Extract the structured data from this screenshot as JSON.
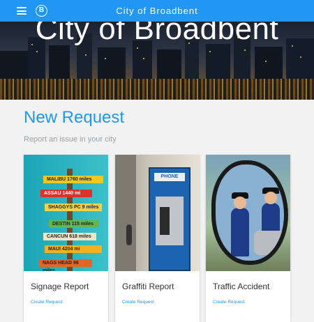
{
  "app": {
    "title": "City of Broadbent",
    "logo_letter": "B"
  },
  "hero": {
    "title": "City of Broadbent"
  },
  "section": {
    "title": "New Request",
    "subtitle": "Report an issue in your city"
  },
  "cards": [
    {
      "title": "Signage Report",
      "link": "Create Request",
      "signs": [
        "MALIBU 1760 miles",
        "ASSAU 1440 mi",
        "SHAGGYS PC 9 miles",
        "DESTIN 115 miles",
        "CANCUN 618 miles",
        "MAUI 4204 mi",
        "NAGS HEAD 96 miles"
      ]
    },
    {
      "title": "Graffiti Report",
      "link": "Create Request",
      "booth_label": "PHONE"
    },
    {
      "title": "Traffic Accident",
      "link": "Create Request"
    }
  ],
  "colors": {
    "primary": "#2196f3",
    "subtitle": "#9aa0a6",
    "card_title": "#333333"
  }
}
